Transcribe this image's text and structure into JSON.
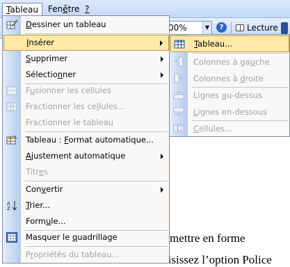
{
  "menubar": {
    "items": [
      {
        "pre": "",
        "u": "T",
        "post": "ableau"
      },
      {
        "pre": "Fen",
        "u": "ê",
        "post": "tre"
      },
      {
        "pre": "",
        "u": "?",
        "post": ""
      }
    ]
  },
  "toolbar": {
    "zoom_value": "00%",
    "help_glyph": "?",
    "reading_label": "Lecture"
  },
  "document": {
    "line1": "mettre en forme",
    "line2": "Dans le menu Format choisissez l’option Police"
  },
  "table_menu": {
    "items": [
      {
        "pre": "",
        "u": "D",
        "post": "essiner un tableau",
        "disabled": false,
        "submenu": false,
        "icon": "pencil-icon"
      },
      {
        "pre": "",
        "u": "I",
        "post": "nsérer",
        "disabled": false,
        "submenu": true,
        "icon": ""
      },
      {
        "pre": "",
        "u": "S",
        "post": "upprimer",
        "disabled": false,
        "submenu": true,
        "icon": ""
      },
      {
        "pre": "Sélectio",
        "u": "n",
        "post": "ner",
        "disabled": false,
        "submenu": true,
        "icon": ""
      },
      {
        "pre": "F",
        "u": "u",
        "post": "sionner les cellules",
        "disabled": true,
        "submenu": false,
        "icon": "merge-cells-icon"
      },
      {
        "pre": "Fractionner les ce",
        "u": "l",
        "post": "lules...",
        "disabled": true,
        "submenu": false,
        "icon": "split-cells-icon"
      },
      {
        "pre": "Fractionner le tableau",
        "u": "",
        "post": "",
        "disabled": true,
        "submenu": false,
        "icon": ""
      },
      {
        "pre": "Tableau : ",
        "u": "F",
        "post": "ormat automatique...",
        "disabled": false,
        "submenu": false,
        "icon": "autoformat-icon"
      },
      {
        "pre": "",
        "u": "A",
        "post": "justement automatique",
        "disabled": false,
        "submenu": true,
        "icon": ""
      },
      {
        "pre": "Titr",
        "u": "e",
        "post": "s",
        "disabled": true,
        "submenu": false,
        "icon": ""
      },
      {
        "pre": "Con",
        "u": "v",
        "post": "ertir",
        "disabled": false,
        "submenu": true,
        "icon": ""
      },
      {
        "pre": "",
        "u": "T",
        "post": "rier...",
        "disabled": false,
        "submenu": false,
        "icon": "sort-az-icon"
      },
      {
        "pre": "Form",
        "u": "u",
        "post": "le...",
        "disabled": false,
        "submenu": false,
        "icon": ""
      },
      {
        "pre": "Masquer le ",
        "u": "q",
        "post": "uadrillage",
        "disabled": false,
        "submenu": false,
        "icon": "gridlines-icon"
      },
      {
        "pre": "P",
        "u": "r",
        "post": "opriétés du tableau...",
        "disabled": true,
        "submenu": false,
        "icon": ""
      }
    ]
  },
  "insert_submenu": {
    "items": [
      {
        "pre": "",
        "u": "T",
        "post": "ableau...",
        "disabled": false,
        "icon": "insert-table-icon"
      },
      {
        "pre": "Colonnes à ga",
        "u": "u",
        "post": "che",
        "disabled": true,
        "icon": "insert-column-left-icon"
      },
      {
        "pre": "Colonnes à ",
        "u": "d",
        "post": "roite",
        "disabled": true,
        "icon": "insert-column-right-icon"
      },
      {
        "pre": "Lignes ",
        "u": "a",
        "post": "u-dessus",
        "disabled": true,
        "icon": "insert-row-above-icon"
      },
      {
        "pre": "",
        "u": "L",
        "post": "ignes en-dessous",
        "disabled": true,
        "icon": "insert-row-below-icon"
      },
      {
        "pre": "",
        "u": "C",
        "post": "ellules...",
        "disabled": true,
        "icon": "insert-cells-icon"
      }
    ]
  },
  "colors": {
    "menu_highlight": "#ffe9a8",
    "menu_highlight_border": "#c59a3a",
    "disabled_text": "#a3a3a3",
    "menubar_bg": "#c3d7f5"
  }
}
